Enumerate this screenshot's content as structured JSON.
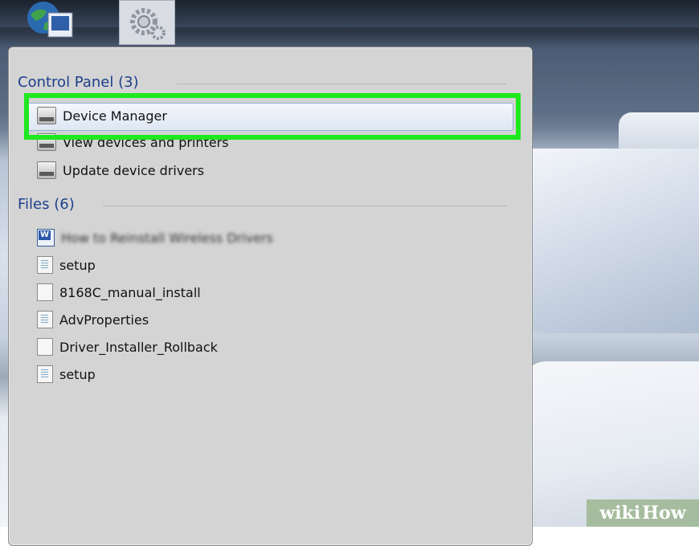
{
  "panel": {
    "control_panel_header": "Control Panel (3)",
    "control_panel_items": [
      "Device Manager",
      "View devices and printers",
      "Update device drivers"
    ],
    "files_header": "Files (6)",
    "file_items": [
      "How to Reinstall Wireless Drivers",
      "setup",
      "8168C_manual_install",
      "AdvProperties",
      "Driver_Installer_Rollback",
      "setup"
    ]
  },
  "highlight_color": "#1ee81e",
  "watermark": {
    "part1": "wiki",
    "part2": "How"
  },
  "icons": {
    "taskbar": [
      "globe-icon",
      "gear-icon"
    ],
    "control_panel": [
      "device-manager-icon",
      "printer-icon",
      "device-manager-icon"
    ],
    "files": [
      "word-doc-icon",
      "text-file-icon",
      "blank-file-icon",
      "text-file-icon",
      "blank-file-icon",
      "text-file-icon"
    ]
  }
}
